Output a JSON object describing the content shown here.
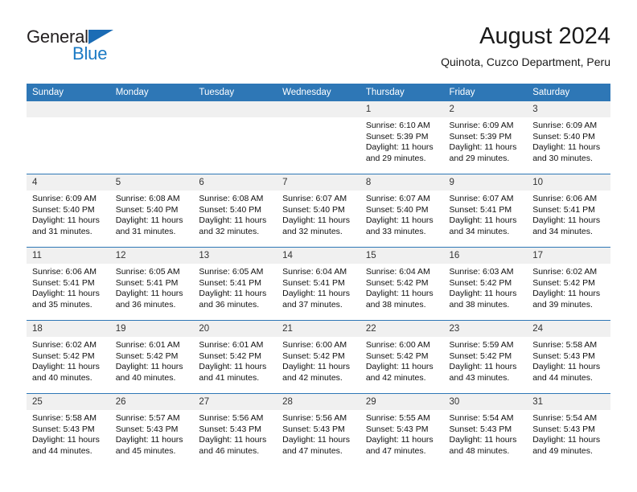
{
  "brand": {
    "line1": "General",
    "line2": "Blue",
    "triangle_icon": "brand-triangle-icon",
    "colors": {
      "text_dark": "#231f20",
      "blue": "#1b7ac4",
      "triangle": "#1b6cb5"
    }
  },
  "header": {
    "title": "August 2024",
    "subtitle": "Quinota, Cuzco Department, Peru"
  },
  "theme": {
    "header_bg": "#2e77b6",
    "header_text": "#ffffff",
    "daynum_strip_bg": "#f0f0f0",
    "cell_bg": "#ffffff",
    "row_divider": "#2e77b6"
  },
  "weekday_headers": [
    "Sunday",
    "Monday",
    "Tuesday",
    "Wednesday",
    "Thursday",
    "Friday",
    "Saturday"
  ],
  "weeks": [
    [
      {
        "day": "",
        "empty": true,
        "sunrise": "",
        "sunset": "",
        "daylight1": "",
        "daylight2": ""
      },
      {
        "day": "",
        "empty": true,
        "sunrise": "",
        "sunset": "",
        "daylight1": "",
        "daylight2": ""
      },
      {
        "day": "",
        "empty": true,
        "sunrise": "",
        "sunset": "",
        "daylight1": "",
        "daylight2": ""
      },
      {
        "day": "",
        "empty": true,
        "sunrise": "",
        "sunset": "",
        "daylight1": "",
        "daylight2": ""
      },
      {
        "day": "1",
        "empty": false,
        "sunrise": "Sunrise: 6:10 AM",
        "sunset": "Sunset: 5:39 PM",
        "daylight1": "Daylight: 11 hours",
        "daylight2": "and 29 minutes."
      },
      {
        "day": "2",
        "empty": false,
        "sunrise": "Sunrise: 6:09 AM",
        "sunset": "Sunset: 5:39 PM",
        "daylight1": "Daylight: 11 hours",
        "daylight2": "and 29 minutes."
      },
      {
        "day": "3",
        "empty": false,
        "sunrise": "Sunrise: 6:09 AM",
        "sunset": "Sunset: 5:40 PM",
        "daylight1": "Daylight: 11 hours",
        "daylight2": "and 30 minutes."
      }
    ],
    [
      {
        "day": "4",
        "empty": false,
        "sunrise": "Sunrise: 6:09 AM",
        "sunset": "Sunset: 5:40 PM",
        "daylight1": "Daylight: 11 hours",
        "daylight2": "and 31 minutes."
      },
      {
        "day": "5",
        "empty": false,
        "sunrise": "Sunrise: 6:08 AM",
        "sunset": "Sunset: 5:40 PM",
        "daylight1": "Daylight: 11 hours",
        "daylight2": "and 31 minutes."
      },
      {
        "day": "6",
        "empty": false,
        "sunrise": "Sunrise: 6:08 AM",
        "sunset": "Sunset: 5:40 PM",
        "daylight1": "Daylight: 11 hours",
        "daylight2": "and 32 minutes."
      },
      {
        "day": "7",
        "empty": false,
        "sunrise": "Sunrise: 6:07 AM",
        "sunset": "Sunset: 5:40 PM",
        "daylight1": "Daylight: 11 hours",
        "daylight2": "and 32 minutes."
      },
      {
        "day": "8",
        "empty": false,
        "sunrise": "Sunrise: 6:07 AM",
        "sunset": "Sunset: 5:40 PM",
        "daylight1": "Daylight: 11 hours",
        "daylight2": "and 33 minutes."
      },
      {
        "day": "9",
        "empty": false,
        "sunrise": "Sunrise: 6:07 AM",
        "sunset": "Sunset: 5:41 PM",
        "daylight1": "Daylight: 11 hours",
        "daylight2": "and 34 minutes."
      },
      {
        "day": "10",
        "empty": false,
        "sunrise": "Sunrise: 6:06 AM",
        "sunset": "Sunset: 5:41 PM",
        "daylight1": "Daylight: 11 hours",
        "daylight2": "and 34 minutes."
      }
    ],
    [
      {
        "day": "11",
        "empty": false,
        "sunrise": "Sunrise: 6:06 AM",
        "sunset": "Sunset: 5:41 PM",
        "daylight1": "Daylight: 11 hours",
        "daylight2": "and 35 minutes."
      },
      {
        "day": "12",
        "empty": false,
        "sunrise": "Sunrise: 6:05 AM",
        "sunset": "Sunset: 5:41 PM",
        "daylight1": "Daylight: 11 hours",
        "daylight2": "and 36 minutes."
      },
      {
        "day": "13",
        "empty": false,
        "sunrise": "Sunrise: 6:05 AM",
        "sunset": "Sunset: 5:41 PM",
        "daylight1": "Daylight: 11 hours",
        "daylight2": "and 36 minutes."
      },
      {
        "day": "14",
        "empty": false,
        "sunrise": "Sunrise: 6:04 AM",
        "sunset": "Sunset: 5:41 PM",
        "daylight1": "Daylight: 11 hours",
        "daylight2": "and 37 minutes."
      },
      {
        "day": "15",
        "empty": false,
        "sunrise": "Sunrise: 6:04 AM",
        "sunset": "Sunset: 5:42 PM",
        "daylight1": "Daylight: 11 hours",
        "daylight2": "and 38 minutes."
      },
      {
        "day": "16",
        "empty": false,
        "sunrise": "Sunrise: 6:03 AM",
        "sunset": "Sunset: 5:42 PM",
        "daylight1": "Daylight: 11 hours",
        "daylight2": "and 38 minutes."
      },
      {
        "day": "17",
        "empty": false,
        "sunrise": "Sunrise: 6:02 AM",
        "sunset": "Sunset: 5:42 PM",
        "daylight1": "Daylight: 11 hours",
        "daylight2": "and 39 minutes."
      }
    ],
    [
      {
        "day": "18",
        "empty": false,
        "sunrise": "Sunrise: 6:02 AM",
        "sunset": "Sunset: 5:42 PM",
        "daylight1": "Daylight: 11 hours",
        "daylight2": "and 40 minutes."
      },
      {
        "day": "19",
        "empty": false,
        "sunrise": "Sunrise: 6:01 AM",
        "sunset": "Sunset: 5:42 PM",
        "daylight1": "Daylight: 11 hours",
        "daylight2": "and 40 minutes."
      },
      {
        "day": "20",
        "empty": false,
        "sunrise": "Sunrise: 6:01 AM",
        "sunset": "Sunset: 5:42 PM",
        "daylight1": "Daylight: 11 hours",
        "daylight2": "and 41 minutes."
      },
      {
        "day": "21",
        "empty": false,
        "sunrise": "Sunrise: 6:00 AM",
        "sunset": "Sunset: 5:42 PM",
        "daylight1": "Daylight: 11 hours",
        "daylight2": "and 42 minutes."
      },
      {
        "day": "22",
        "empty": false,
        "sunrise": "Sunrise: 6:00 AM",
        "sunset": "Sunset: 5:42 PM",
        "daylight1": "Daylight: 11 hours",
        "daylight2": "and 42 minutes."
      },
      {
        "day": "23",
        "empty": false,
        "sunrise": "Sunrise: 5:59 AM",
        "sunset": "Sunset: 5:42 PM",
        "daylight1": "Daylight: 11 hours",
        "daylight2": "and 43 minutes."
      },
      {
        "day": "24",
        "empty": false,
        "sunrise": "Sunrise: 5:58 AM",
        "sunset": "Sunset: 5:43 PM",
        "daylight1": "Daylight: 11 hours",
        "daylight2": "and 44 minutes."
      }
    ],
    [
      {
        "day": "25",
        "empty": false,
        "sunrise": "Sunrise: 5:58 AM",
        "sunset": "Sunset: 5:43 PM",
        "daylight1": "Daylight: 11 hours",
        "daylight2": "and 44 minutes."
      },
      {
        "day": "26",
        "empty": false,
        "sunrise": "Sunrise: 5:57 AM",
        "sunset": "Sunset: 5:43 PM",
        "daylight1": "Daylight: 11 hours",
        "daylight2": "and 45 minutes."
      },
      {
        "day": "27",
        "empty": false,
        "sunrise": "Sunrise: 5:56 AM",
        "sunset": "Sunset: 5:43 PM",
        "daylight1": "Daylight: 11 hours",
        "daylight2": "and 46 minutes."
      },
      {
        "day": "28",
        "empty": false,
        "sunrise": "Sunrise: 5:56 AM",
        "sunset": "Sunset: 5:43 PM",
        "daylight1": "Daylight: 11 hours",
        "daylight2": "and 47 minutes."
      },
      {
        "day": "29",
        "empty": false,
        "sunrise": "Sunrise: 5:55 AM",
        "sunset": "Sunset: 5:43 PM",
        "daylight1": "Daylight: 11 hours",
        "daylight2": "and 47 minutes."
      },
      {
        "day": "30",
        "empty": false,
        "sunrise": "Sunrise: 5:54 AM",
        "sunset": "Sunset: 5:43 PM",
        "daylight1": "Daylight: 11 hours",
        "daylight2": "and 48 minutes."
      },
      {
        "day": "31",
        "empty": false,
        "sunrise": "Sunrise: 5:54 AM",
        "sunset": "Sunset: 5:43 PM",
        "daylight1": "Daylight: 11 hours",
        "daylight2": "and 49 minutes."
      }
    ]
  ]
}
